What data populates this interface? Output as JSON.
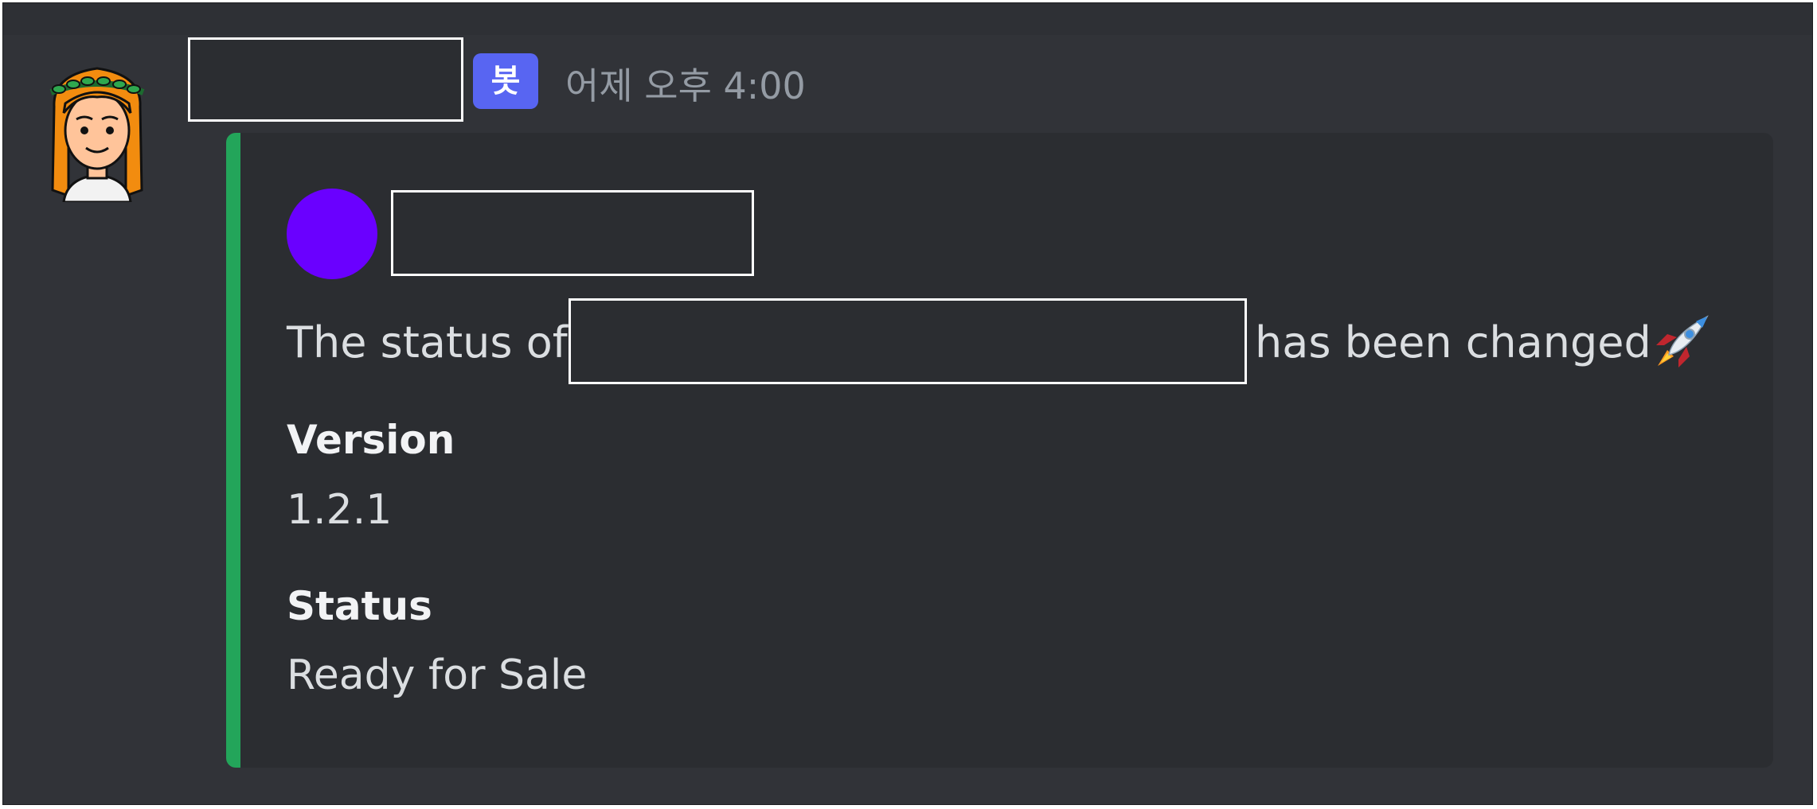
{
  "message": {
    "bot_badge": "봇",
    "timestamp": "어제 오후 4:00"
  },
  "embed": {
    "accent_color": "#23a55a",
    "author_icon_color": "#6a00ff",
    "description_prefix": "The status of",
    "description_suffix": "has been changed",
    "description_emoji": "rocket-emoji",
    "fields": [
      {
        "name": "Version",
        "value": "1.2.1"
      },
      {
        "name": "Status",
        "value": "Ready for Sale"
      }
    ]
  }
}
